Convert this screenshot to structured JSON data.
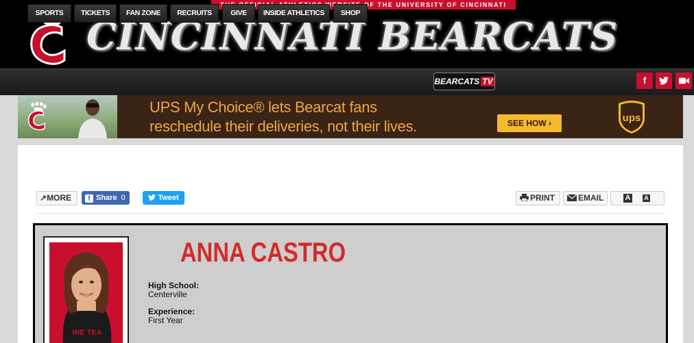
{
  "header": {
    "tagline": "THE OFFICIAL ATHLETICS WEBSITE OF THE UNIVERSITY OF CINCINNATI",
    "brand": "CINCINNATI BEARCATS"
  },
  "nav": {
    "items": [
      "SPORTS",
      "TICKETS",
      "FAN ZONE",
      "RECRUITS",
      "GIVE",
      "INSIDE ATHLETICS",
      "SHOP"
    ],
    "bearcats_tv": "BEARCATS",
    "tv": "TV"
  },
  "ad": {
    "line1": "UPS My Choice® lets Bearcat fans",
    "line2": "reschedule their deliveries, not their lives.",
    "cta": "SEE HOW ›"
  },
  "toolbar": {
    "more": "MORE",
    "share": "Share",
    "share_count": "0",
    "tweet": "Tweet",
    "print": "PRINT",
    "email": "EMAIL",
    "font_large": "A",
    "font_small": "A"
  },
  "profile": {
    "name": "ANNA CASTRO",
    "high_school_label": "High School:",
    "high_school": "Centerville",
    "experience_label": "Experience:",
    "experience": "First Year"
  },
  "colors": {
    "brand_red": "#c8102e",
    "name_red": "#d32b2b",
    "ups_brown": "#3a2416",
    "ups_gold": "#f5b82e"
  }
}
